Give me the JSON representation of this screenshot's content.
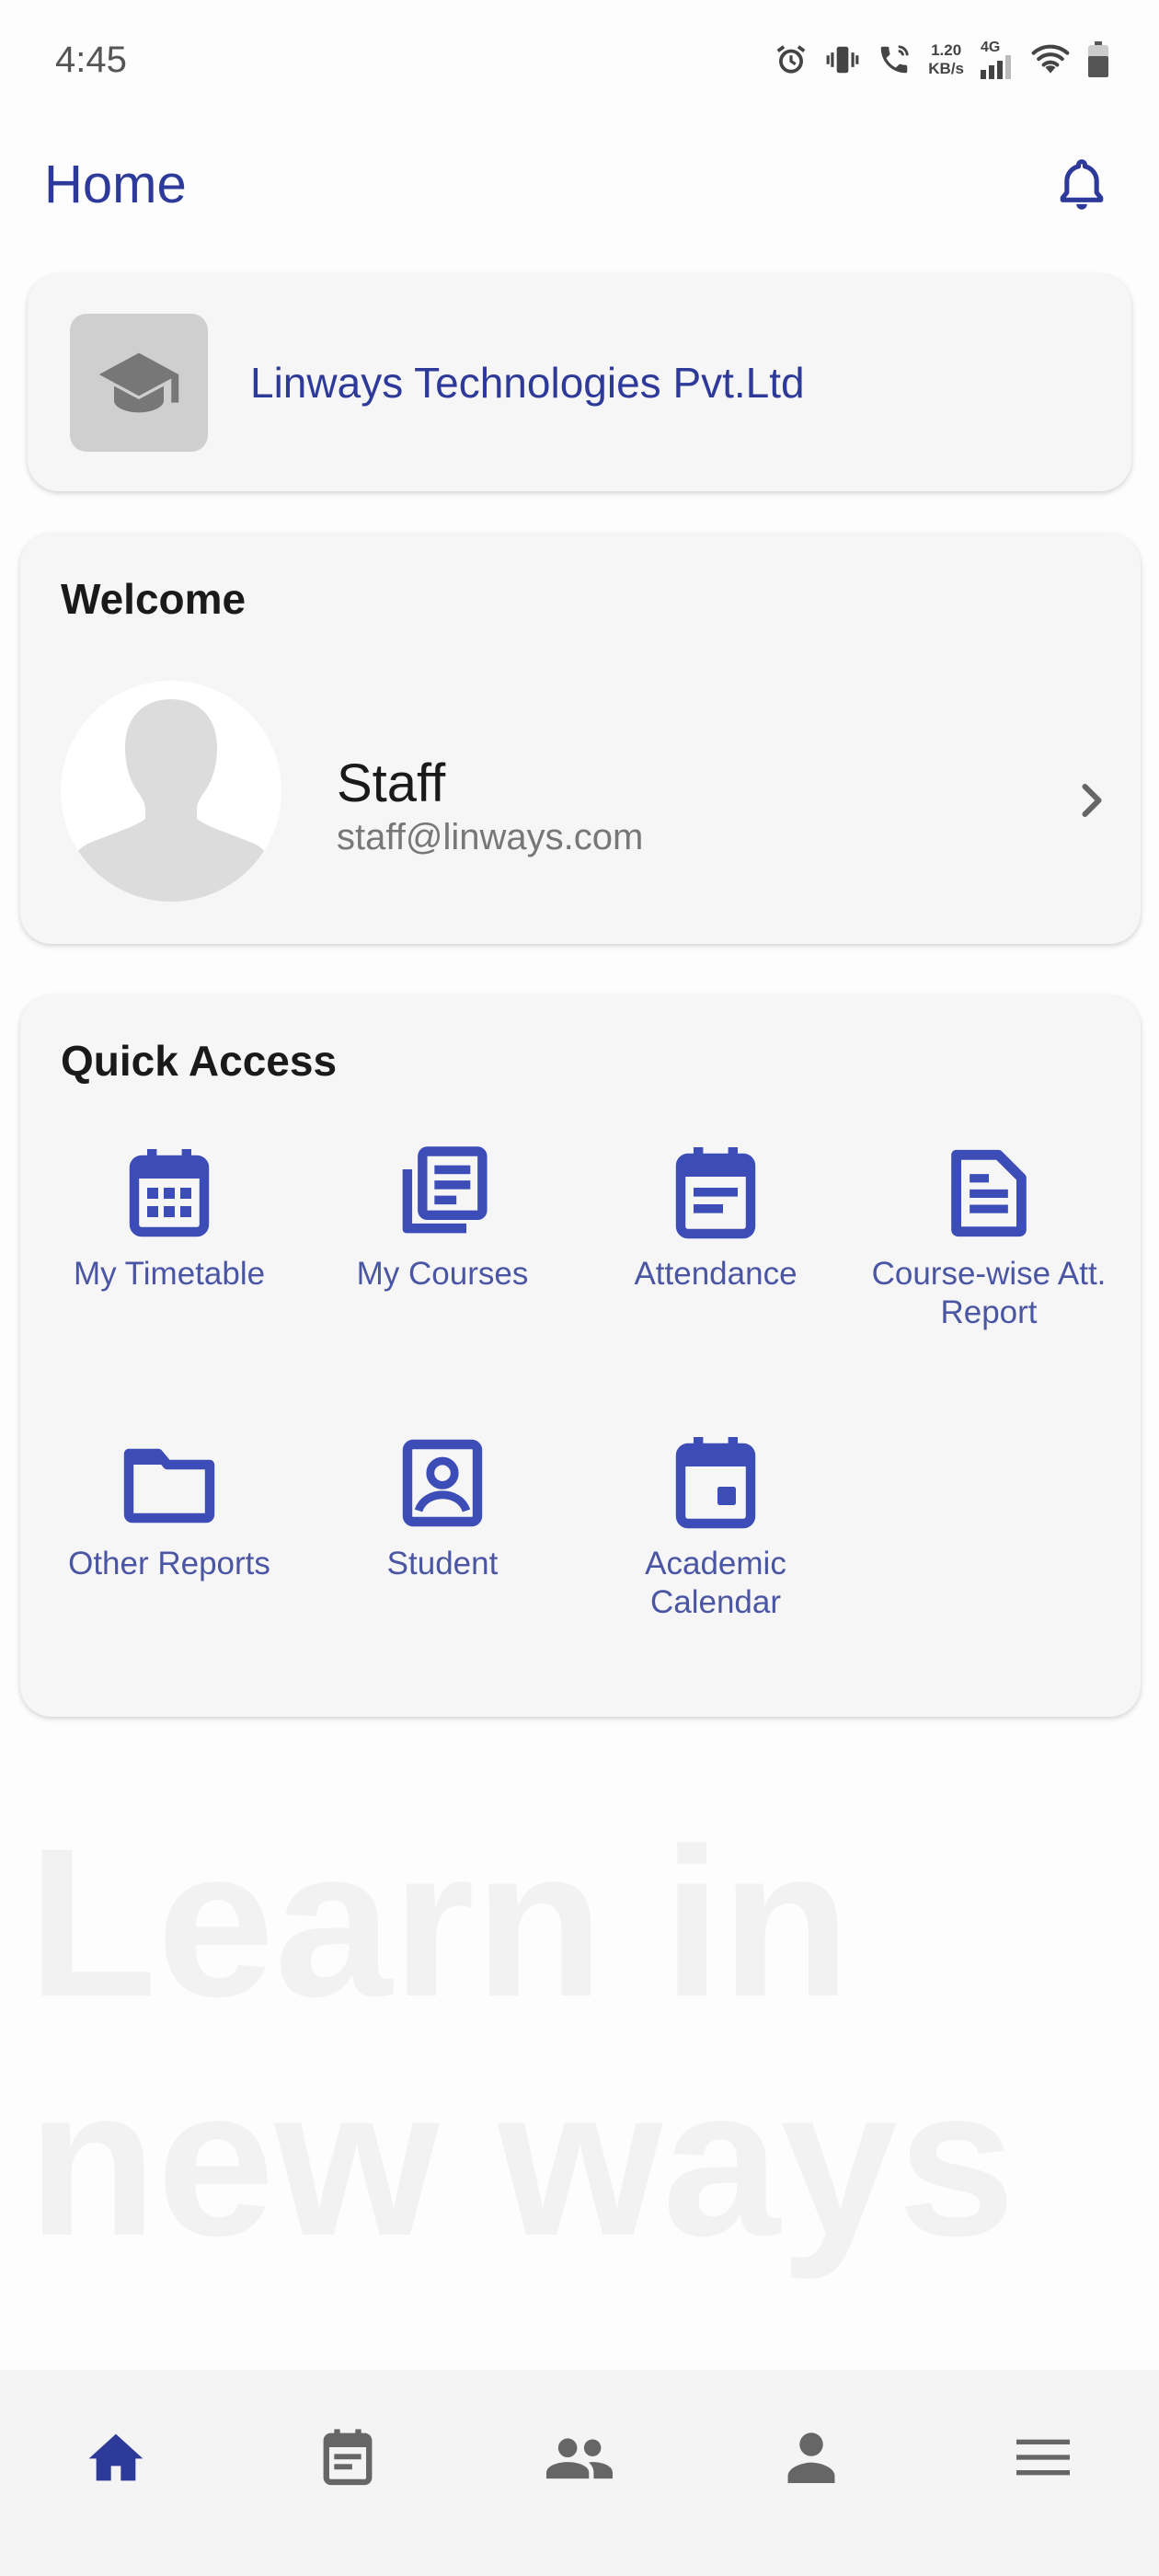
{
  "status_bar": {
    "time": "4:45",
    "net_speed_value": "1.20",
    "net_speed_unit": "KB/s",
    "network_type": "4G",
    "icons": [
      "alarm-icon",
      "vibrate-icon",
      "wifi-calling-icon",
      "signal-icon",
      "wifi-icon",
      "battery-icon"
    ]
  },
  "header": {
    "title": "Home",
    "notification_icon": "bell-icon"
  },
  "organization": {
    "name": "Linways Technologies Pvt.Ltd",
    "logo_icon": "graduation-cap-icon"
  },
  "welcome": {
    "heading": "Welcome",
    "user_name": "Staff",
    "user_email": "staff@linways.com",
    "avatar_icon": "default-avatar-icon",
    "chevron_icon": "chevron-right-icon"
  },
  "quick_access": {
    "heading": "Quick Access",
    "items": [
      {
        "label": "My Timetable",
        "icon": "calendar-grid-icon"
      },
      {
        "label": "My Courses",
        "icon": "library-books-icon"
      },
      {
        "label": "Attendance",
        "icon": "event-note-icon"
      },
      {
        "label": "Course-wise Att. Report",
        "icon": "document-icon"
      },
      {
        "label": "Other Reports",
        "icon": "folder-icon"
      },
      {
        "label": "Student",
        "icon": "contact-portrait-icon"
      },
      {
        "label": "Academic Calendar",
        "icon": "calendar-event-icon"
      }
    ]
  },
  "watermark": {
    "text": "Learn in new ways"
  },
  "bottom_nav": {
    "items": [
      {
        "icon": "home-icon",
        "active": true
      },
      {
        "icon": "event-note-icon",
        "active": false
      },
      {
        "icon": "people-icon",
        "active": false
      },
      {
        "icon": "person-icon",
        "active": false
      },
      {
        "icon": "menu-icon",
        "active": false
      }
    ]
  },
  "colors": {
    "primary": "#2e3a99",
    "icon_blue": "#3d4db7",
    "label_blue": "#4a56a3",
    "card_bg": "#f6f6f6",
    "nav_inactive": "#666666"
  }
}
